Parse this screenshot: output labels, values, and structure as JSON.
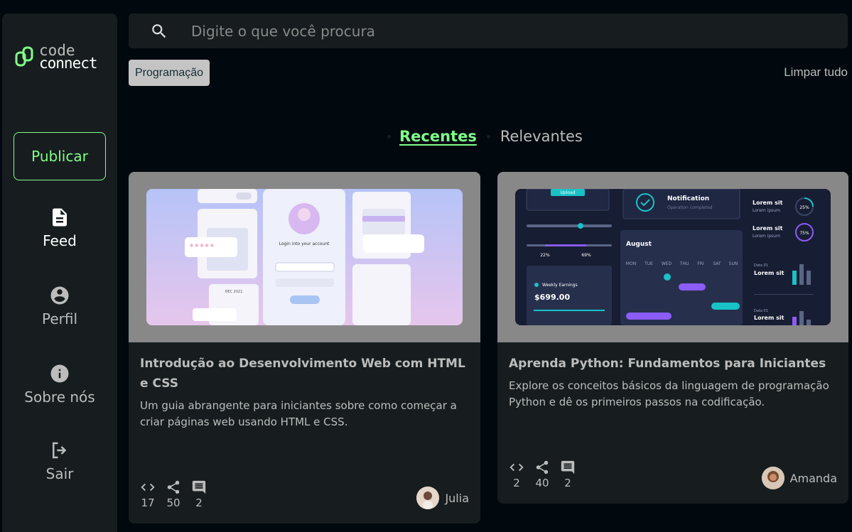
{
  "colors": {
    "accent": "#81fe88",
    "panel": "#171d1f",
    "background": "#01080e",
    "muted": "#bcbcbc"
  },
  "logo": {
    "line1": "code",
    "line2": "connect"
  },
  "sidebar": {
    "publish_label": "Publicar",
    "items": [
      {
        "label": "Feed",
        "icon": "document-icon"
      },
      {
        "label": "Perfil",
        "icon": "account-icon"
      },
      {
        "label": "Sobre nós",
        "icon": "info-icon"
      },
      {
        "label": "Sair",
        "icon": "logout-icon"
      }
    ]
  },
  "search": {
    "placeholder": "Digite o que você procura",
    "value": ""
  },
  "filters": {
    "tag": "Programação",
    "clear_label": "Limpar tudo"
  },
  "tabs": [
    {
      "label": "Recentes",
      "active": true
    },
    {
      "label": "Relevantes",
      "active": false
    }
  ],
  "cards": [
    {
      "title": "Introdução ao Desenvolvimento Web com HTML e CSS",
      "description": "Um guia abrangente para iniciantes sobre como começar a criar páginas web usando HTML e CSS.",
      "stats": {
        "code": "17",
        "share": "50",
        "comments": "2"
      },
      "author": "Julia",
      "thumb": {
        "login_title": "Login into your account",
        "calendar_title": "DEC 2021"
      }
    },
    {
      "title": "Aprenda Python: Fundamentos para Iniciantes",
      "description": "Explore os conceitos básicos da linguagem de programação Python e dê os primeiros passos na codificação.",
      "stats": {
        "code": "2",
        "share": "40",
        "comments": "2"
      },
      "author": "Amanda",
      "thumb": {
        "upload": "Upload",
        "notification_title": "Notification",
        "notification_sub": "Operation completed",
        "slider_left": "22%",
        "slider_right": "69%",
        "month": "August",
        "weekdays": [
          "MON",
          "TUE",
          "WED",
          "THU",
          "FRI",
          "SAT",
          "SUN"
        ],
        "earnings_label": "Weekly Earnings",
        "earnings_value": "$699.00",
        "lorem_title": "Lorem sit",
        "lorem_sub": "Lorem ipsum",
        "pct1": "25%",
        "pct2": "75%",
        "data_label": "Data 01"
      }
    }
  ]
}
